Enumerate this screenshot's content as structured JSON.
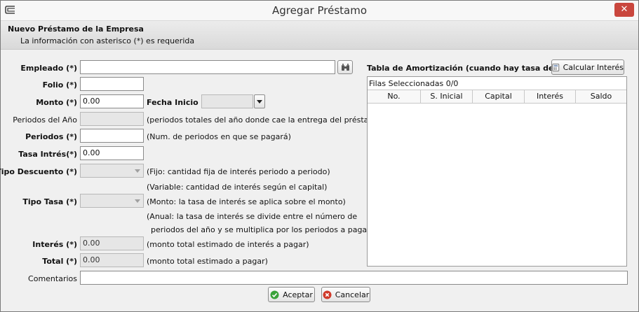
{
  "window": {
    "title": "Agregar Préstamo",
    "close_glyph": "✕"
  },
  "banner": {
    "title": "Nuevo Préstamo de la Empresa",
    "subtitle": "La información con asterisco (*) es requerida"
  },
  "form": {
    "empleado": {
      "label": "Empleado (*)",
      "value": ""
    },
    "folio": {
      "label": "Folio (*)",
      "value": ""
    },
    "monto": {
      "label": "Monto (*)",
      "value": "0.00"
    },
    "fecha_inicio": {
      "label": "Fecha Inicio (*)",
      "value": ""
    },
    "periodos_anio": {
      "label": "Periodos del Año",
      "value": "",
      "note": "(periodos totales del año donde cae la entrega del préstamo)"
    },
    "periodos": {
      "label": "Periodos (*)",
      "value": "",
      "note": "(Num. de periodos en que se pagará)"
    },
    "tasa_interes": {
      "label": "Tasa Intrés(*)",
      "value": "0.00"
    },
    "tipo_descuento": {
      "label": "Tipo Descuento (*)",
      "value": "",
      "note1": "(Fijo: cantidad fija de interés periodo a periodo)",
      "note2": "(Variable: cantidad de interés según el capital)"
    },
    "tipo_tasa": {
      "label": "Tipo Tasa (*)",
      "value": "",
      "note1": "(Monto: la tasa de interés se aplica sobre el monto)",
      "note2": "(Anual: la tasa de interés se divide entre el número de",
      "note3": "periodos del año y se multiplica por los periodos a pagar)"
    },
    "interes": {
      "label": "Interés (*)",
      "value": "0.00",
      "note": "(monto total estimado de interés a pagar)"
    },
    "total": {
      "label": "Total (*)",
      "value": "0.00",
      "note": "(monto total estimado a pagar)"
    },
    "comentarios": {
      "label": "Comentarios",
      "value": ""
    }
  },
  "amortization": {
    "title": "Tabla de Amortización (cuando hay tasa de interés)",
    "calc_button": "Calcular Interés",
    "rows_selected": "Filas Seleccionadas  0/0",
    "columns": [
      "No.",
      "S. Inicial",
      "Capital",
      "Interés",
      "Saldo"
    ],
    "rows": []
  },
  "actions": {
    "accept": "Aceptar",
    "cancel": "Cancelar"
  },
  "colors": {
    "accept_icon": "#3aa33a",
    "cancel_icon": "#d03a2a",
    "close_button": "#c9463d"
  }
}
